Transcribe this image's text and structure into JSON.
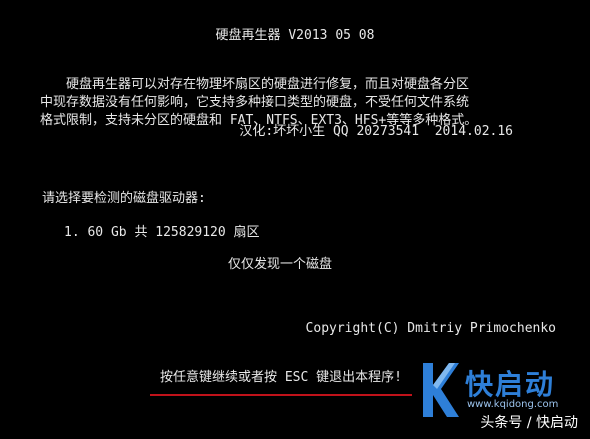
{
  "title": "硬盘再生器 V2013 05 08",
  "description": {
    "line1": "硬盘再生器可以对存在物理坏扇区的硬盘进行修复，而且对硬盘各分区",
    "line2": "中现存数据没有任何影响，它支持多种接口类型的硬盘，不受任何文件系统",
    "line3": "格式限制，支持未分区的硬盘和 FAT、NTFS、EXT3、HFS+等等多种格式。"
  },
  "credit": "汉化:坏坏小生 QQ 20273541  2014.02.16",
  "prompt": "请选择要检测的磁盘驱动器:",
  "drives": [
    {
      "label": "1. 60 Gb 共 125829120 扇区"
    }
  ],
  "found_message": "仅仅发现一个磁盘",
  "copyright": "Copyright(C) Dmitriy Primochenko",
  "exit_prompt": "按任意键继续或者按 ESC 键退出本程序!",
  "watermark": {
    "brand": "快启动",
    "url": "www.kqidong.com",
    "tag": "头条号 / 快启动",
    "color": "#2e7fd8"
  },
  "colors": {
    "background": "#000000",
    "text": "#e8e8e8",
    "underline": "#c0121a"
  }
}
